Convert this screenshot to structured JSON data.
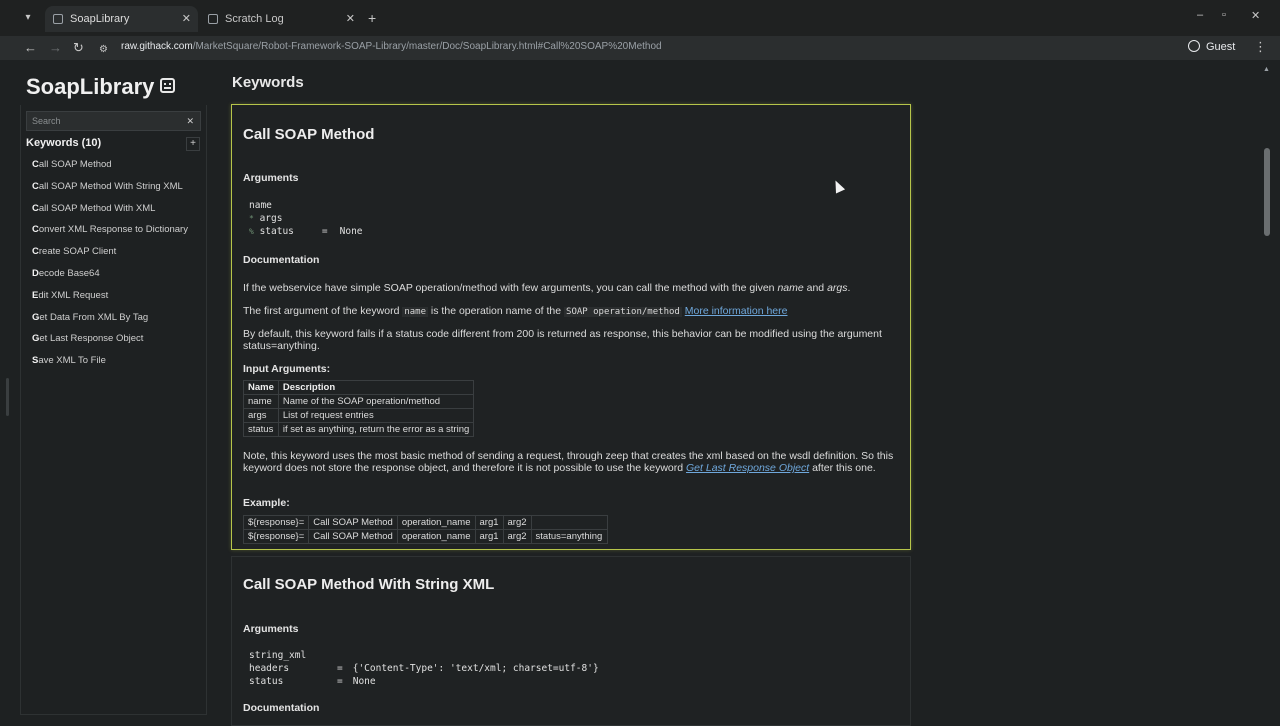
{
  "browser": {
    "tabs": [
      {
        "title": "SoapLibrary",
        "active": true
      },
      {
        "title": "Scratch Log",
        "active": false
      }
    ],
    "new_tab_label": "+",
    "url_host": "raw.githack.com",
    "url_path": "/MarketSquare/Robot-Framework-SOAP-Library/master/Doc/SoapLibrary.html#Call%20SOAP%20Method",
    "profile_label": "Guest"
  },
  "sidebar": {
    "logo": "SoapLibrary",
    "search_placeholder": "Search",
    "keywords_header": "Keywords (10)",
    "expand_label": "+",
    "items": [
      {
        "initial": "C",
        "rest": "all SOAP Method"
      },
      {
        "initial": "C",
        "rest": "all SOAP Method With String XML"
      },
      {
        "initial": "C",
        "rest": "all SOAP Method With XML"
      },
      {
        "initial": "C",
        "rest": "onvert XML Response to Dictionary"
      },
      {
        "initial": "C",
        "rest": "reate SOAP Client"
      },
      {
        "initial": "D",
        "rest": "ecode Base64"
      },
      {
        "initial": "E",
        "rest": "dit XML Request"
      },
      {
        "initial": "G",
        "rest": "et Data From XML By Tag"
      },
      {
        "initial": "G",
        "rest": "et Last Response Object"
      },
      {
        "initial": "S",
        "rest": "ave XML To File"
      }
    ]
  },
  "main": {
    "heading": "Keywords",
    "kw1": {
      "title": "Call SOAP Method",
      "arguments_label": "Arguments",
      "args": [
        {
          "prefix": "",
          "name": "name",
          "eq": "",
          "val": ""
        },
        {
          "prefix": "*",
          "name": "args",
          "eq": "",
          "val": ""
        },
        {
          "prefix": "%",
          "name": "status",
          "eq": "=",
          "val": "None"
        }
      ],
      "documentation_label": "Documentation",
      "doc1_pre": "If the webservice have simple SOAP operation/method with few arguments, you can call the method with the given ",
      "doc1_em1": "name",
      "doc1_mid": " and ",
      "doc1_em2": "args",
      "doc1_post": ".",
      "doc2_pre": "The first argument of the keyword ",
      "doc2_code1": "name",
      "doc2_mid": " is the operation name of the ",
      "doc2_code2": "SOAP operation/method",
      "doc2_link": "More information here",
      "doc3": "By default, this keyword fails if a status code different from 200 is returned as response, this behavior can be modified using the argument status=anything.",
      "input_args_label": "Input Arguments:",
      "input_table_headers": [
        "Name",
        "Description"
      ],
      "input_table_rows": [
        [
          "name",
          "Name of the SOAP operation/method"
        ],
        [
          "args",
          "List of request entries"
        ],
        [
          "status",
          "if set as anything, return the error as a string"
        ]
      ],
      "note_pre": "Note, this keyword uses the most basic method of sending a request, through zeep that creates the xml based on the wsdl definition. So this keyword does not store the response object, and therefore it is not possible to use the keyword ",
      "note_link": "Get Last Response Object",
      "note_post": " after this one.",
      "example_label": "Example:",
      "example_rows": [
        [
          "${response}=",
          "Call SOAP Method",
          "operation_name",
          "arg1",
          "arg2",
          ""
        ],
        [
          "${response}=",
          "Call SOAP Method",
          "operation_name",
          "arg1",
          "arg2",
          "status=anything"
        ]
      ]
    },
    "kw2": {
      "title": "Call SOAP Method With String XML",
      "arguments_label": "Arguments",
      "args": [
        {
          "name": "string_xml",
          "eq": "",
          "val": ""
        },
        {
          "name": "headers",
          "eq": "=",
          "val": "{'Content-Type': 'text/xml; charset=utf-8'}"
        },
        {
          "name": "status",
          "eq": "=",
          "val": "None"
        }
      ],
      "documentation_label": "Documentation"
    }
  }
}
